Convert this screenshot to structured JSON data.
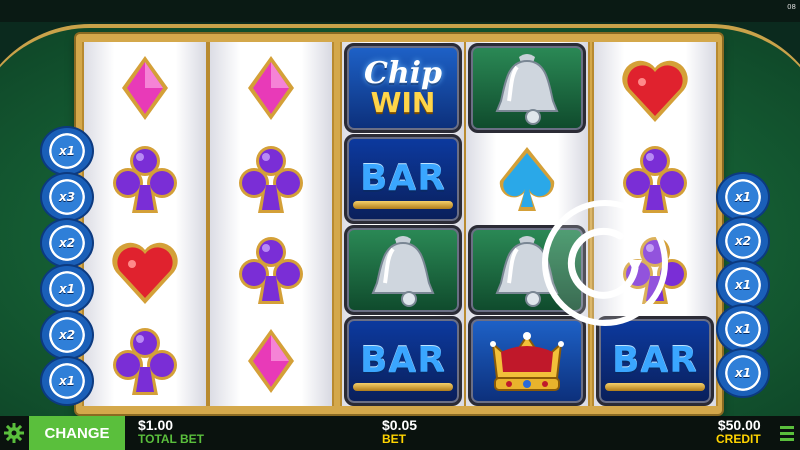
{
  "status": {
    "clock": "08"
  },
  "reels": [
    [
      "diamond-pink",
      "club-purple",
      "heart-red",
      "club-purple"
    ],
    [
      "diamond-pink",
      "club-purple",
      "club-purple",
      "diamond-pink"
    ],
    [
      "chip-win",
      "bar",
      "bell",
      "bar"
    ],
    [
      "bell",
      "spade-blue",
      "bell",
      "crown"
    ],
    [
      "heart-red",
      "club-purple",
      "club-purple",
      "bar"
    ]
  ],
  "symbols": {
    "bar": {
      "label": "BAR"
    },
    "chip_win": {
      "line1": "Chip",
      "line2": "WIN"
    }
  },
  "left_chips": [
    "x1",
    "x3",
    "x2",
    "x1",
    "x2",
    "x1"
  ],
  "right_chips": [
    "x1",
    "x2",
    "x1",
    "x1",
    "x1"
  ],
  "colors": {
    "accent_green": "#5abf3c",
    "bet_yellow": "#ffd400",
    "felt": "#145b32",
    "gold": "#d4a84b"
  },
  "footer": {
    "change_label": "CHANGE",
    "total_bet_value": "$1.00",
    "total_bet_label": "TOTAL BET",
    "bet_value": "$0.05",
    "bet_label": "BET",
    "credit_value": "$50.00",
    "credit_label": "CREDIT"
  },
  "icons": {
    "settings": "gear-icon",
    "spin": "spin-icon",
    "menu": "hamburger-icon"
  }
}
